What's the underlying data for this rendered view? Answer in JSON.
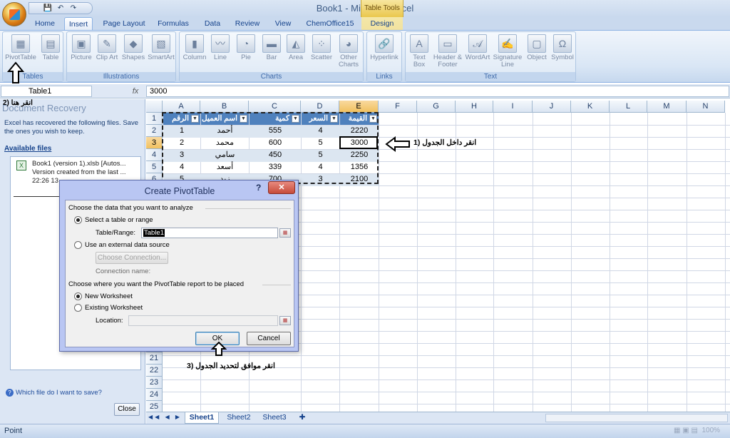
{
  "window": {
    "title": "Book1 - Microsoft Excel",
    "context_tab": "Table Tools"
  },
  "qat": [
    "💾",
    "↶",
    "↷",
    "▾"
  ],
  "tabs": [
    "Home",
    "Insert",
    "Page Layout",
    "Formulas",
    "Data",
    "Review",
    "View",
    "ChemOffice15",
    "Design"
  ],
  "ribbon": {
    "groups": [
      {
        "label": "Tables",
        "buttons": [
          "PivotTable",
          "Table"
        ]
      },
      {
        "label": "Illustrations",
        "buttons": [
          "Picture",
          "Clip Art",
          "Shapes",
          "SmartArt"
        ]
      },
      {
        "label": "Charts",
        "buttons": [
          "Column",
          "Line",
          "Pie",
          "Bar",
          "Area",
          "Scatter",
          "Other Charts"
        ]
      },
      {
        "label": "Links",
        "buttons": [
          "Hyperlink"
        ]
      },
      {
        "label": "Text",
        "buttons": [
          "Text Box",
          "Header & Footer",
          "WordArt",
          "Signature Line",
          "Object",
          "Symbol"
        ]
      }
    ]
  },
  "formula_bar": {
    "name_box": "Table1",
    "fx": "fx",
    "value": "3000"
  },
  "recovery": {
    "annotation": "2) انقر هنا",
    "title": "Document Recovery",
    "message": "Excel has recovered the following files. Save the ones you wish to keep.",
    "available": "Available files",
    "file_line1": "Book1 (version 1).xlsb  [Autos...",
    "file_line2": "Version created from the last ...",
    "file_line3": "22:26 13",
    "help": "Which file do I want to save?",
    "close": "Close"
  },
  "columns": [
    "A",
    "B",
    "C",
    "D",
    "E",
    "F",
    "G",
    "H",
    "I",
    "J",
    "K",
    "L",
    "M",
    "N"
  ],
  "rows": [
    "1",
    "2",
    "3",
    "4",
    "5",
    "6",
    "21",
    "22",
    "23",
    "24",
    "25"
  ],
  "table": {
    "headers": [
      "الرقم",
      "اسم العميل",
      "كمية المبيعات",
      "السعر",
      "القيمة"
    ],
    "rows": [
      [
        "1",
        "أحمد",
        "555",
        "4",
        "2220"
      ],
      [
        "2",
        "محمد",
        "600",
        "5",
        "3000"
      ],
      [
        "3",
        "سامي",
        "450",
        "5",
        "2250"
      ],
      [
        "4",
        "أسعد",
        "339",
        "4",
        "1356"
      ],
      [
        "5",
        "زيد",
        "700",
        "3",
        "2100"
      ]
    ]
  },
  "annotations": {
    "step1": "1) انقر داخل الجدول",
    "step3": "3) انقر موافق لتحديد الجدول"
  },
  "sheets": [
    "Sheet1",
    "Sheet2",
    "Sheet3"
  ],
  "status": {
    "mode": "Point",
    "zoom": "100%"
  },
  "dialog": {
    "title": "Create PivotTable",
    "help": "?",
    "close": "✕",
    "section1": "Choose the data that you want to analyze",
    "opt_select": "Select a table or range",
    "range_label": "Table/Range:",
    "range_value": "Table1",
    "opt_external": "Use an external data source",
    "choose_conn": "Choose Connection...",
    "conn_name": "Connection name:",
    "section2": "Choose where you want the PivotTable report to be placed",
    "opt_new": "New Worksheet",
    "opt_existing": "Existing Worksheet",
    "location_label": "Location:",
    "ok": "OK",
    "cancel": "Cancel"
  }
}
